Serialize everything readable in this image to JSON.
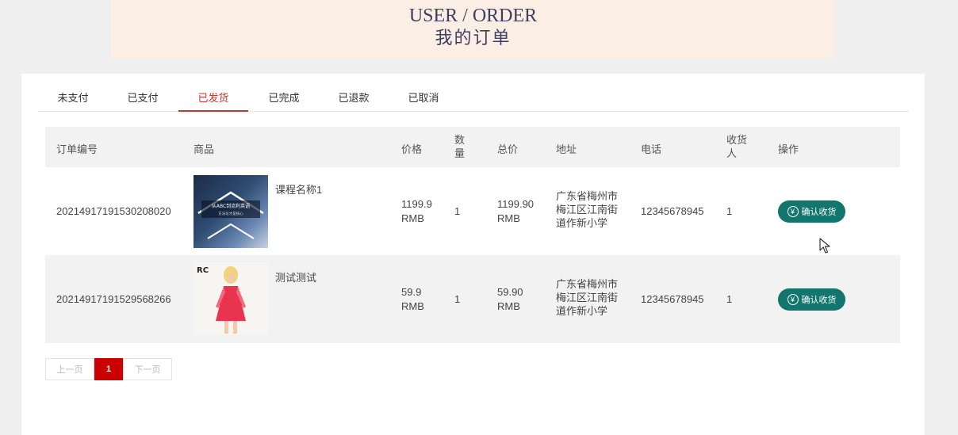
{
  "banner": {
    "title_en": "USER / ORDER",
    "title_cn": "我的订单"
  },
  "tabs": [
    "未支付",
    "已支付",
    "已发货",
    "已完成",
    "已退款",
    "已取消"
  ],
  "active_tab": "已发货",
  "table": {
    "headers": {
      "order_no": "订单编号",
      "product": "商品",
      "price": "价格",
      "qty_line1": "数",
      "qty_line2": "量",
      "total": "总价",
      "address": "地址",
      "phone": "电话",
      "receiver_line1": "收货",
      "receiver_line2": "人",
      "action": "操作"
    },
    "rows": [
      {
        "order_no": "20214917191530208020",
        "product_name": "课程名称1",
        "thumb_text_1": "从ABC到流利英语",
        "thumb_text_2": "方法论才是核心",
        "price_line1": "1199.9",
        "price_line2": "RMB",
        "qty": "1",
        "total_line1": "1199.90",
        "total_line2": "RMB",
        "addr_line1": "广东省梅州市",
        "addr_line2": "梅江区江南街",
        "addr_line3": "道作新小学",
        "phone": "12345678945",
        "receiver": "1",
        "action_label": "确认收货"
      },
      {
        "order_no": "20214917191529568266",
        "product_name": "测试测试",
        "thumb_text_1": "RC",
        "price_line1": "59.9",
        "price_line2": "RMB",
        "qty": "1",
        "total_line1": "59.90",
        "total_line2": "RMB",
        "addr_line1": "广东省梅州市",
        "addr_line2": "梅江区江南街",
        "addr_line3": "道作新小学",
        "phone": "12345678945",
        "receiver": "1",
        "action_label": "确认收货"
      }
    ]
  },
  "pagination": {
    "prev": "上一页",
    "current": "1",
    "next": "下一页"
  },
  "icons": {
    "confirm": "yen-icon",
    "cursor": "mouse-pointer-icon"
  },
  "colors": {
    "accent": "#c0392b",
    "button": "#12756e",
    "page_current": "#cc0000"
  }
}
